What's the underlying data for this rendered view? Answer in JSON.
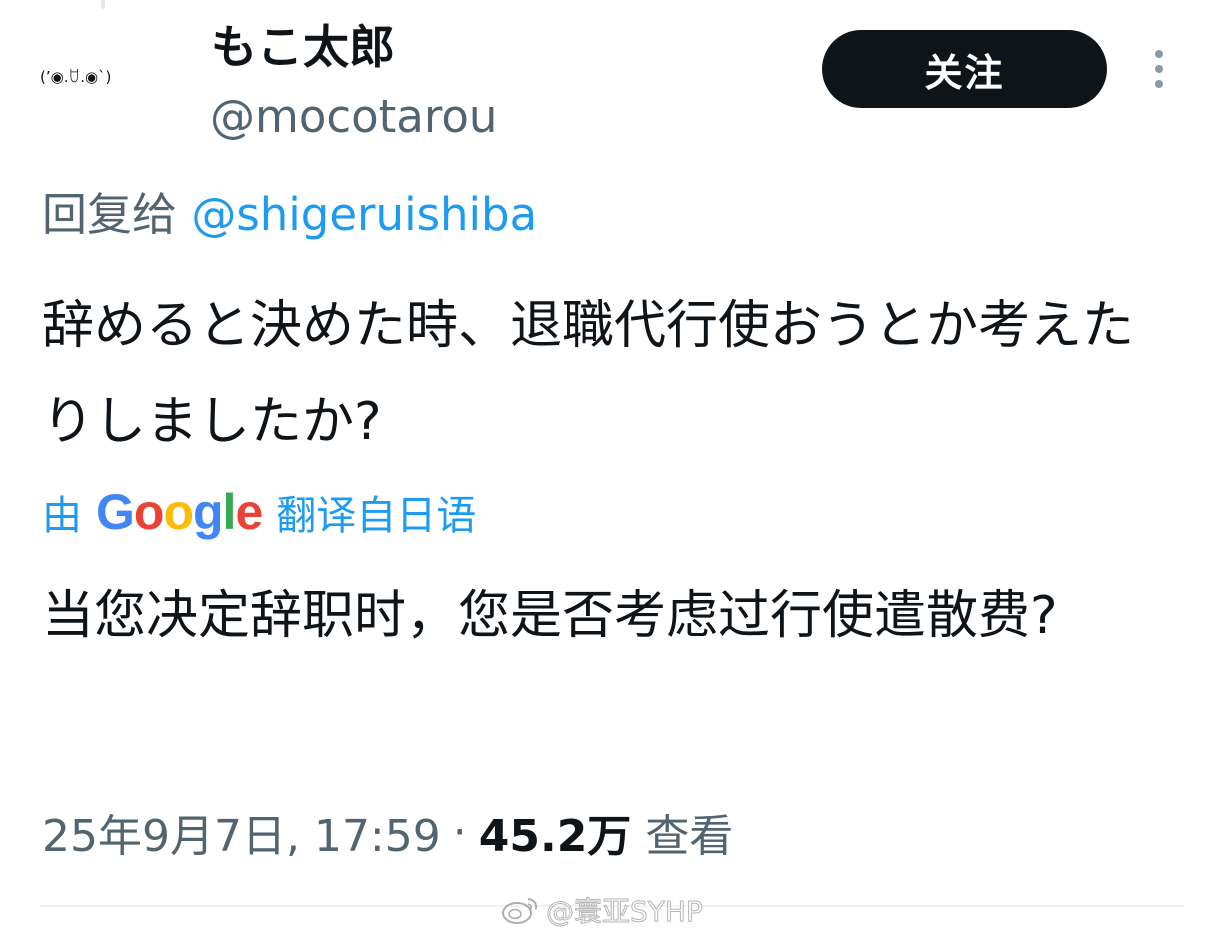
{
  "author": {
    "avatar_text": "(’◉.ꇴ.◉`)",
    "display_name": "もこ太郎",
    "handle": "@mocotarou"
  },
  "header": {
    "follow_label": "关注",
    "more_icon": "more-vertical-icon"
  },
  "reply": {
    "prefix": "回复给",
    "mention": "@shigeruishiba"
  },
  "tweet": {
    "text": "辞めると決めた時、退職代行使おうとか考えたりしましたか?"
  },
  "translation": {
    "prefix": "由",
    "google_letters": [
      "G",
      "o",
      "o",
      "g",
      "l",
      "e"
    ],
    "suffix": "翻译自日语",
    "text": "当您决定辞职时，您是否考虑过行使遣散费?"
  },
  "meta": {
    "timestamp": "25年9月7日, 17:59",
    "separator": "·",
    "views_count": "45.2万",
    "views_label": "查看"
  },
  "watermark": {
    "text": "@寰亚SYHP",
    "icon": "weibo-icon"
  },
  "colors": {
    "text_primary": "#0f1419",
    "text_secondary": "#536471",
    "link": "#1d9bf0",
    "button_bg": "#0f1419",
    "google_blue": "#4285f4",
    "google_red": "#ea4335",
    "google_yellow": "#fbbc05",
    "google_green": "#34a853"
  }
}
